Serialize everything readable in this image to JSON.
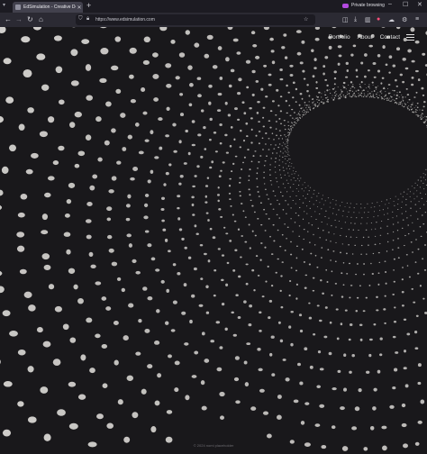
{
  "browser": {
    "tab_title": "EdSimulation - Creative Devel...",
    "new_tab": "+",
    "url": "https://www.edsimulation.com",
    "private_label": "Private browsing"
  },
  "site": {
    "nav": [
      "Portfolio",
      "About",
      "Contact"
    ],
    "footer": "© 2024 nomi placeholder"
  },
  "icons": [
    "back-icon",
    "forward-icon",
    "reload-icon",
    "home-icon",
    "shield-icon",
    "lock-icon",
    "star-icon",
    "menu-icon"
  ],
  "colors": {
    "background": "#19181b",
    "dots": "#e8e6e2",
    "tab": "#42414d",
    "private": "#b44ae0"
  }
}
